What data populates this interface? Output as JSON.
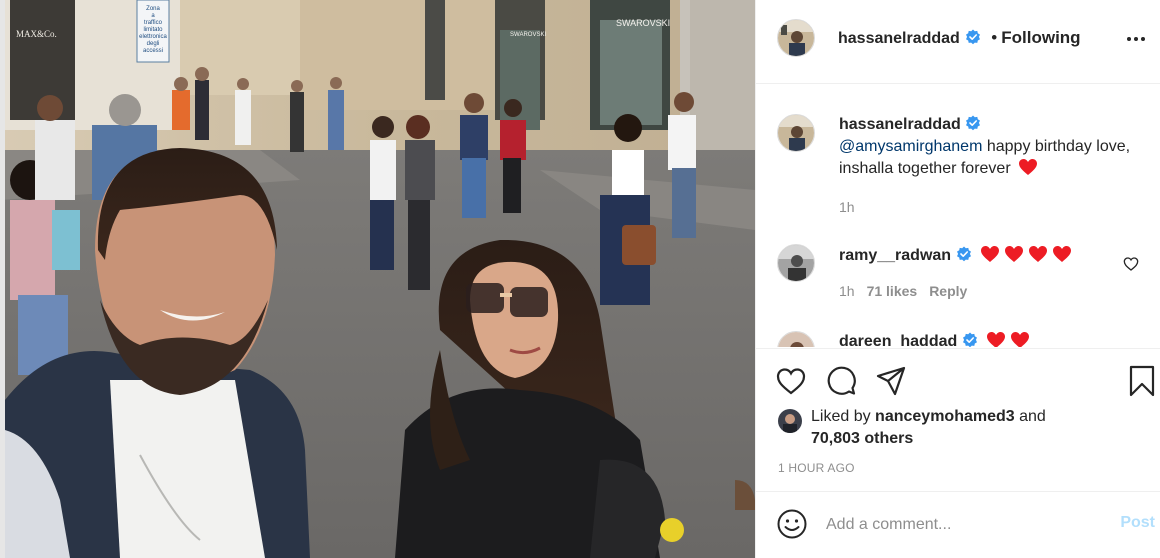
{
  "post": {
    "author": {
      "username": "hassanelraddad",
      "verified": true,
      "follow_status": "Following"
    },
    "photo_signs": {
      "store_left": "MAX&Co.",
      "store_right": "SWAROVSKI",
      "street_sign_lines": [
        "Zona",
        "a",
        "traffico",
        "limitato",
        "elettronica",
        "degli",
        "accessi"
      ]
    }
  },
  "caption": {
    "username": "hassanelraddad",
    "mention": "@amysamirghanem",
    "text": " happy birthday love, inshalla together forever",
    "emoji": "red-heart-icon",
    "time": "1h"
  },
  "comments": [
    {
      "username": "ramy__radwan",
      "verified": true,
      "hearts": 4,
      "time": "1h",
      "likes": "71 likes",
      "reply": "Reply"
    },
    {
      "username": "dareen_haddad",
      "verified": true,
      "hearts": 2
    }
  ],
  "actions": {
    "icons": [
      "heart-icon",
      "comment-icon",
      "share-icon",
      "bookmark-icon"
    ]
  },
  "likes": {
    "prefix": "Liked by ",
    "user": "nanceymohamed3",
    "connector": " and",
    "others": "70,803 others"
  },
  "timeago": "1 HOUR AGO",
  "add_comment": {
    "placeholder": "Add a comment...",
    "post_label": "Post"
  },
  "colors": {
    "verified": "#3897f0",
    "heart": "#ed4956",
    "text": "#262626",
    "muted": "#8e8e8e",
    "mention": "#00376b",
    "post_disabled": "#b2dffc"
  }
}
